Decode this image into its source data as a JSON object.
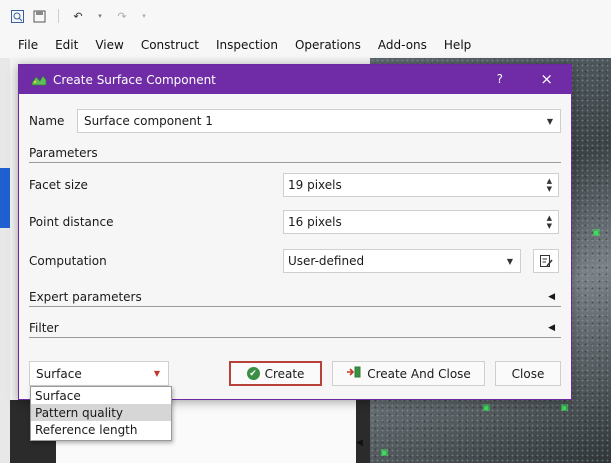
{
  "menubar": {
    "items": [
      "File",
      "Edit",
      "View",
      "Construct",
      "Inspection",
      "Operations",
      "Add-ons",
      "Help"
    ]
  },
  "toolbar": {
    "icons": [
      "zoom-icon",
      "save-icon",
      "undo-icon",
      "redo-icon"
    ]
  },
  "dialog": {
    "title": "Create Surface Component",
    "help": "?",
    "close": "×",
    "name_label": "Name",
    "name_value": "Surface component 1",
    "parameters_header": "Parameters",
    "facet_size_label": "Facet size",
    "facet_size_value": "19 pixels",
    "point_distance_label": "Point distance",
    "point_distance_value": "16 pixels",
    "computation_label": "Computation",
    "computation_value": "User-defined",
    "expert_parameters_header": "Expert parameters",
    "filter_header": "Filter",
    "bottom_combo_value": "Surface",
    "create_label": "Create",
    "create_and_close_label": "Create And Close",
    "close_label": "Close"
  },
  "dropdown": {
    "options": [
      "Surface",
      "Pattern quality",
      "Reference length"
    ],
    "hovered": "Pattern quality"
  },
  "colors": {
    "titlebar": "#6f2ca6",
    "create_border": "#b8413a",
    "check_green": "#3b8f44"
  }
}
